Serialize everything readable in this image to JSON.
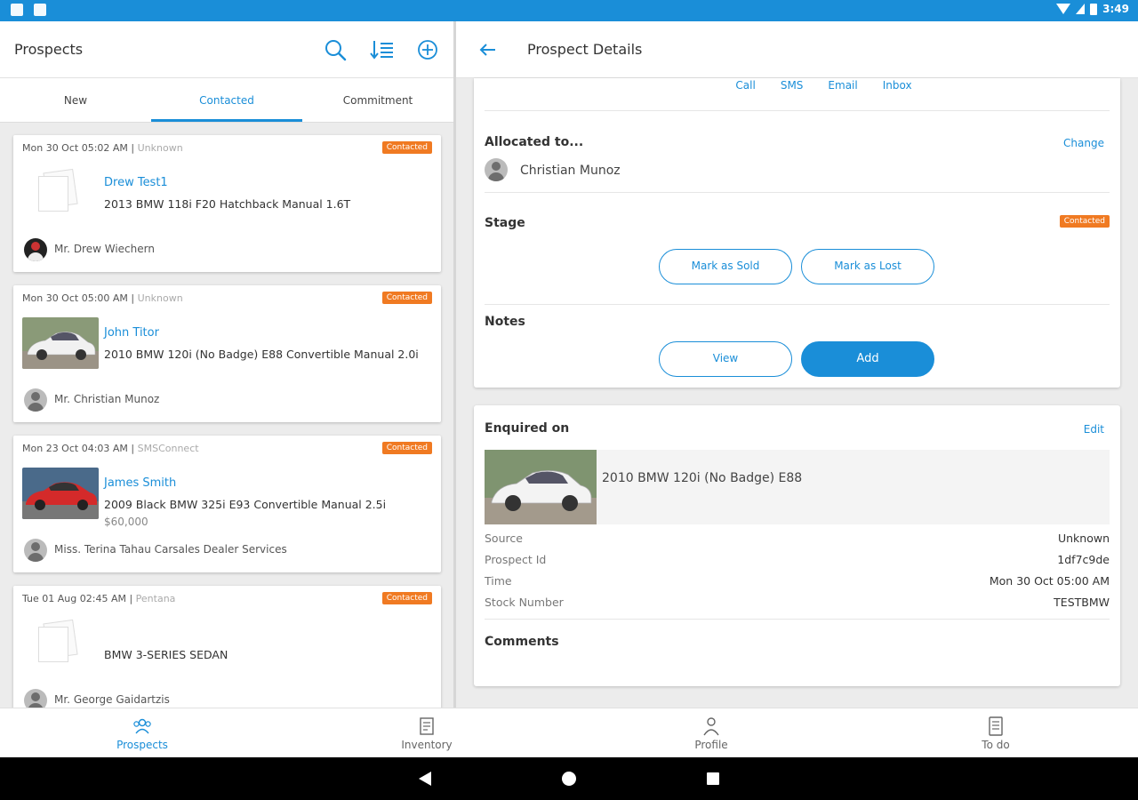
{
  "status_bar": {
    "time": "3:49"
  },
  "left": {
    "title": "Prospects",
    "icons": [
      "search-icon",
      "sort-icon",
      "add-circle-icon"
    ],
    "tabs": [
      {
        "label": "New",
        "active": false
      },
      {
        "label": "Contacted",
        "active": true
      },
      {
        "label": "Commitment",
        "active": false
      }
    ],
    "cards": [
      {
        "time": "Mon 30 Oct 05:02 AM",
        "source": "Unknown",
        "badge": "Contacted",
        "name": "Drew Test1",
        "vehicle": "2013 BMW 118i F20 Hatchback Manual 1.6T",
        "price": "",
        "dealer": "Mr. Drew Wiechern",
        "thumb": "placeholder"
      },
      {
        "time": "Mon 30 Oct 05:00 AM",
        "source": "Unknown",
        "badge": "Contacted",
        "name": "John Titor",
        "vehicle": "2010 BMW 120i (No Badge) E88 Convertible Manual 2.0i",
        "price": "",
        "dealer": "Mr. Christian Munoz",
        "thumb": "white-car"
      },
      {
        "time": "Mon 23 Oct 04:03 AM",
        "source": "SMSConnect",
        "badge": "Contacted",
        "name": "James Smith",
        "vehicle": "2009 Black BMW 325i E93 Convertible Manual 2.5i",
        "price": "$60,000",
        "dealer": "Miss. Terina Tahau Carsales Dealer Services",
        "thumb": "red-car"
      },
      {
        "time": "Tue 01 Aug 02:45 AM",
        "source": "Pentana",
        "badge": "Contacted",
        "name": "",
        "vehicle": "BMW 3-SERIES SEDAN",
        "price": "",
        "dealer": "Mr. George Gaidartzis",
        "thumb": "placeholder"
      }
    ]
  },
  "right": {
    "title": "Prospect Details",
    "actions": [
      "Call",
      "SMS",
      "Email",
      "Inbox"
    ],
    "allocated": {
      "title": "Allocated to...",
      "change": "Change",
      "name": "Christian Munoz"
    },
    "stage": {
      "title": "Stage",
      "badge": "Contacted",
      "sold": "Mark as Sold",
      "lost": "Mark as Lost"
    },
    "notes": {
      "title": "Notes",
      "view": "View",
      "add": "Add"
    },
    "enquired": {
      "title": "Enquired on",
      "edit": "Edit",
      "vehicle": "2010 BMW 120i (No Badge) E88",
      "details": [
        {
          "key": "Source",
          "value": "Unknown"
        },
        {
          "key": "Prospect Id",
          "value": "1df7c9de"
        },
        {
          "key": "Time",
          "value": "Mon 30 Oct 05:00 AM"
        },
        {
          "key": "Stock Number",
          "value": "TESTBMW"
        }
      ],
      "comments": "Comments"
    }
  },
  "bottom_nav": [
    {
      "label": "Prospects",
      "icon": "people-icon",
      "active": true
    },
    {
      "label": "Inventory",
      "icon": "inventory-icon",
      "active": false
    },
    {
      "label": "Profile",
      "icon": "person-icon",
      "active": false
    },
    {
      "label": "To do",
      "icon": "todo-icon",
      "active": false
    }
  ],
  "colors": {
    "accent": "#1a8ed8",
    "badge": "#f07a22"
  }
}
